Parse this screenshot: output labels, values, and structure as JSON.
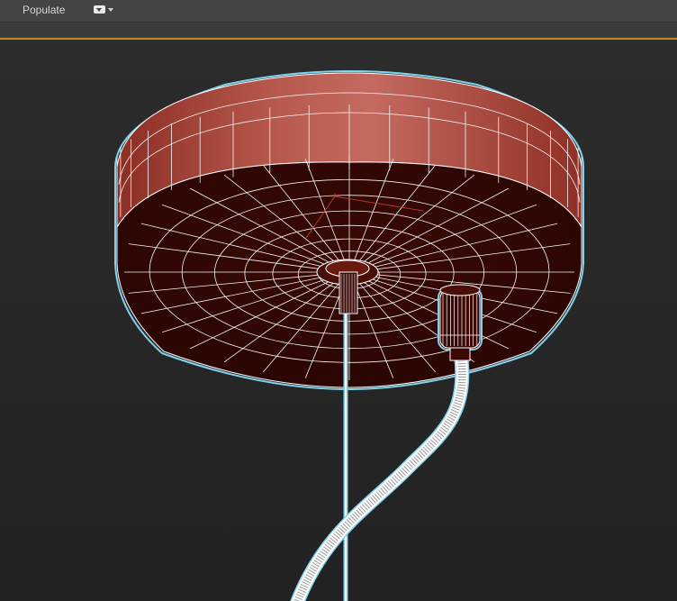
{
  "toolbar": {
    "populate_label": "Populate",
    "dropdown_icon": "dropdown-icon"
  },
  "viewport": {
    "active_border_color": "#c48a1f",
    "wire_color": "#ffffff",
    "selection_outline_color": "#7fd3ee",
    "mesh_color": "#b23a2b"
  }
}
